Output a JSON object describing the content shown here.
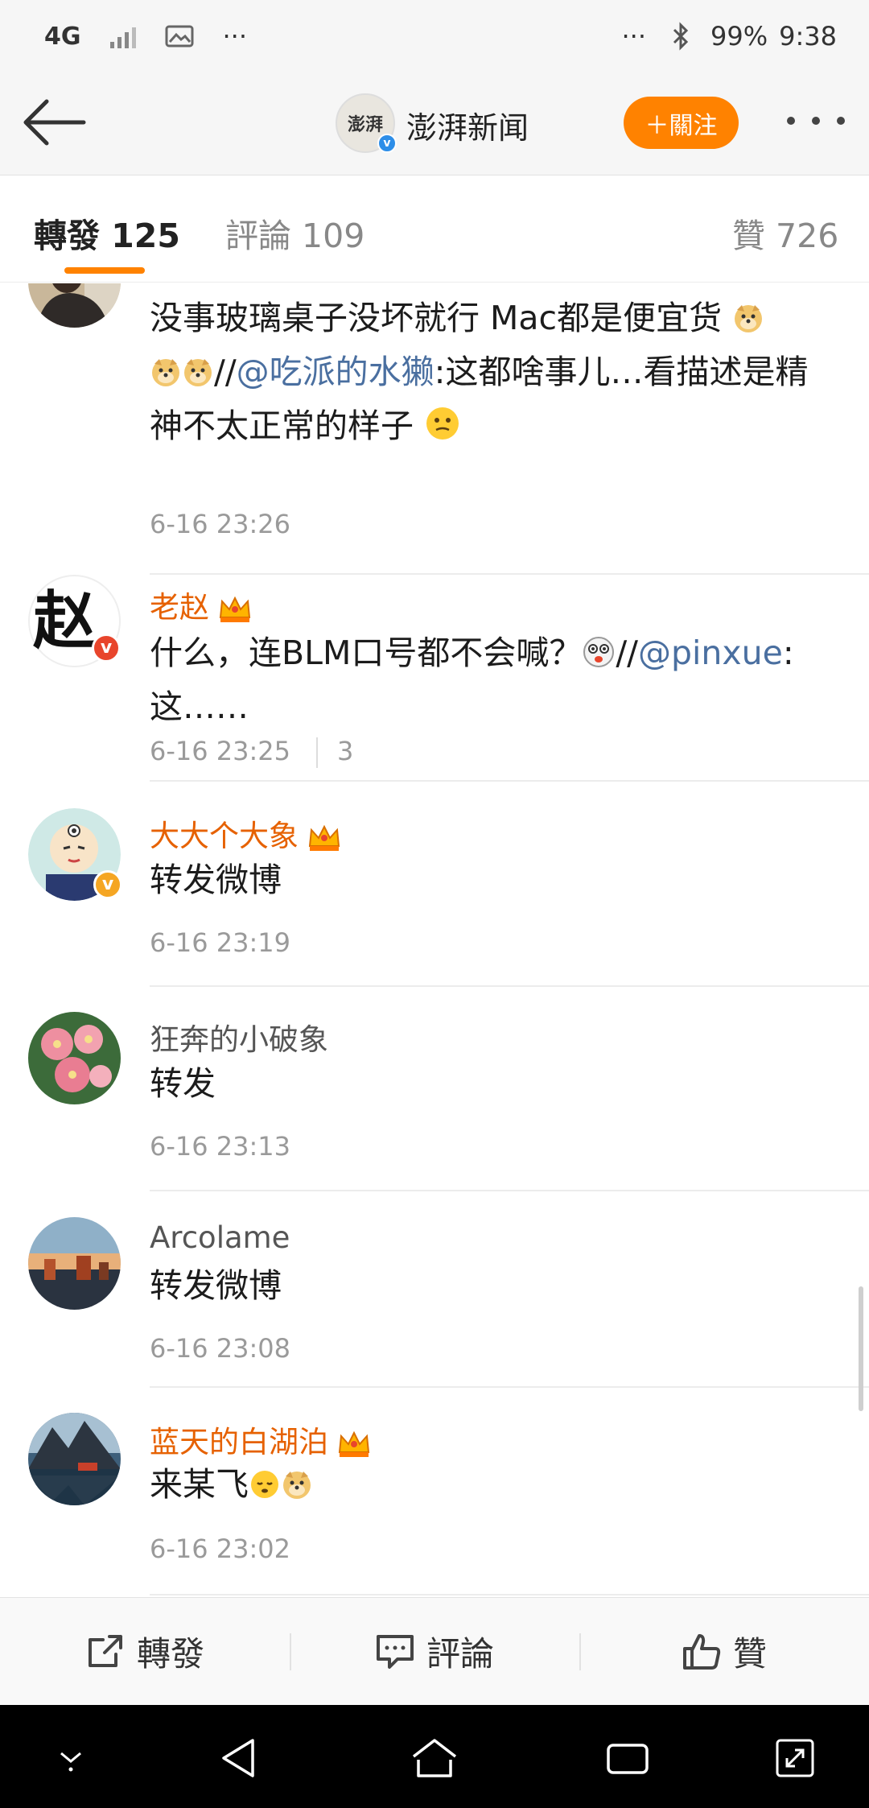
{
  "status_bar": {
    "network": "4G",
    "more": "···",
    "more_right": "···",
    "battery": "99%",
    "time": "9:38"
  },
  "nav": {
    "logo_text": "澎湃",
    "title": "澎湃新闻",
    "follow_label": "＋關注"
  },
  "tabs": [
    {
      "label": "轉發",
      "count": "125"
    },
    {
      "label": "評論",
      "count": "109"
    },
    {
      "label": "贊",
      "count": "726"
    }
  ],
  "reposts": [
    {
      "username": "",
      "text_parts": [
        "没事玻璃桌子没坏就行 Mac都是便宜货",
        "//",
        "@吃派的水獭",
        ":这都啥事儿…看描述是精神不太正常的样子 "
      ],
      "time": "6-16 23:26"
    },
    {
      "username": "老赵",
      "avatar_text": "赵",
      "text_parts": [
        "什么，连BLM口号都不会喊？",
        "//",
        "@pinxue",
        ":这……"
      ],
      "time": "6-16 23:25",
      "count": "3"
    },
    {
      "username": "大大个大象",
      "text": "转发微博",
      "time": "6-16 23:19"
    },
    {
      "username": "狂奔的小破象",
      "text": "转发",
      "time": "6-16 23:13"
    },
    {
      "username": "Arcolame",
      "text": "转发微博",
      "time": "6-16 23:08"
    },
    {
      "username": "蓝天的白湖泊",
      "text": "来某飞",
      "time": "6-16 23:02"
    }
  ],
  "toolbar": {
    "repost_label": "轉發",
    "comment_label": "評論",
    "like_label": "贊"
  },
  "colors": {
    "accent": "#ff8200",
    "vip_name": "#e66100",
    "mention": "#4a6fa0",
    "verified_blue": "#2d8ee8",
    "verified_red": "#e8452c",
    "verified_gold": "#f5a623"
  }
}
